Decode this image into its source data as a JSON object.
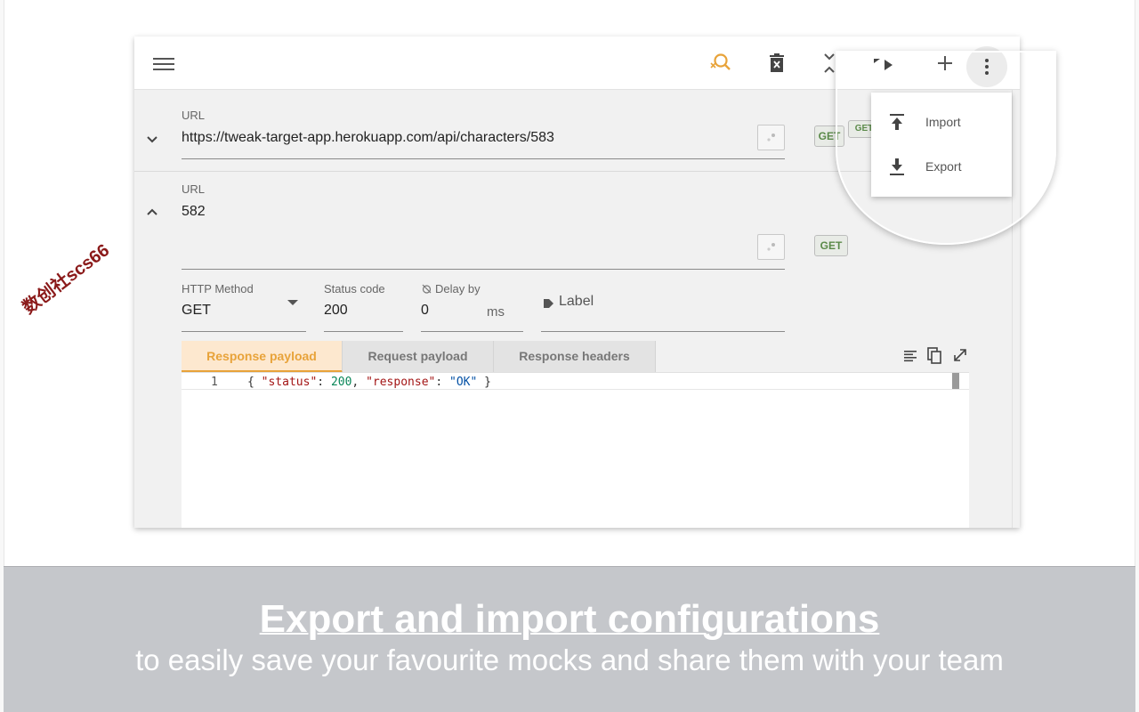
{
  "toolbar": {
    "icons": [
      "menu-icon",
      "search-off-icon",
      "delete-forever-icon",
      "collapse-all-icon",
      "play-icon",
      "add-icon",
      "more-vert-icon"
    ]
  },
  "rules": [
    {
      "url_label": "URL",
      "url_value": "https://tweak-target-app.herokuapp.com/api/characters/583",
      "method_badge": "GET",
      "method_badge_secondary": "GET",
      "expanded": false
    },
    {
      "url_label": "URL",
      "url_value": "582",
      "method_badge": "GET",
      "expanded": true,
      "http_method_label": "HTTP Method",
      "http_method_value": "GET",
      "status_code_label": "Status code",
      "status_code_value": "200",
      "delay_label": "Delay by",
      "delay_value": "0",
      "delay_unit": "ms",
      "label_placeholder": "Label",
      "tabs": [
        "Response payload",
        "Request payload",
        "Response headers"
      ],
      "active_tab": "Response payload",
      "editor": {
        "line_number": "1",
        "code_open": "{ ",
        "key1": "\"status\"",
        "sep1": ": ",
        "val1": "200",
        "comma": ", ",
        "key2": "\"response\"",
        "sep2": ": ",
        "val2": "\"OK\"",
        "code_close": " }"
      }
    }
  ],
  "menu": {
    "items": [
      {
        "label": "Import",
        "icon": "upload-icon"
      },
      {
        "label": "Export",
        "icon": "download-icon"
      }
    ]
  },
  "footer": {
    "headline": "Export and import configurations",
    "subline": "to easily save your favourite mocks and share them with your team"
  },
  "watermark": "数创社scs66",
  "colors": {
    "accent": "#e8a33a",
    "badge_text": "#5b8a4a",
    "footer_bg": "#c5c7cb"
  }
}
